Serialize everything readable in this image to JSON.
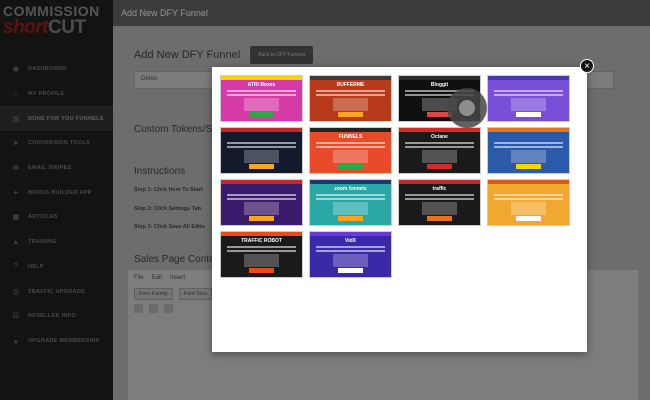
{
  "brand": {
    "line1": "COMMISSION",
    "short": "short",
    "cut": "CUT"
  },
  "sidebar": {
    "items": [
      {
        "label": "DASHBOARD",
        "icon": "dashboard-icon",
        "glyph": "◉"
      },
      {
        "label": "MY PROFILE",
        "icon": "user-icon",
        "glyph": "☺"
      },
      {
        "label": "DONE FOR YOU FUNNELS",
        "icon": "funnel-icon",
        "glyph": "▤",
        "active": true
      },
      {
        "label": "CONVERSION TOOLS",
        "icon": "send-icon",
        "glyph": "➤"
      },
      {
        "label": "EMAIL SWIPES",
        "icon": "email-icon",
        "glyph": "✉"
      },
      {
        "label": "BONUS BUILDER APP",
        "icon": "gift-icon",
        "glyph": "✦"
      },
      {
        "label": "ARTICLES",
        "icon": "document-icon",
        "glyph": "▦"
      },
      {
        "label": "TRAINING",
        "icon": "graduation-icon",
        "glyph": "▲"
      },
      {
        "label": "HELP",
        "icon": "help-icon",
        "glyph": "?"
      },
      {
        "label": "TRAFFIC UPGRADE",
        "icon": "traffic-icon",
        "glyph": "◷"
      },
      {
        "label": "RESELLER INFO",
        "icon": "reseller-icon",
        "glyph": "☷"
      },
      {
        "label": "UPGRADE MEMBERSHIP",
        "icon": "upgrade-icon",
        "glyph": "▴"
      }
    ]
  },
  "topbar": {
    "title": "Add New DFY Funnel"
  },
  "page": {
    "heading": "Add New DFY Funnel",
    "back_button": "Back to DFY Funnels",
    "name_value": "Demo",
    "custom_tokens": "Custom Tokens/S",
    "instructions": "Instructions",
    "step1": "Step 1: Click Here To Start",
    "step2": "Step 2: Click Settings Tab",
    "step3": "Step 3: Click Save All Edits",
    "sales_page": "Sales Page Conte",
    "toolbar": [
      "File",
      "Edit",
      "Insert"
    ],
    "font_family": "Font Family",
    "font_size": "Font Size"
  },
  "modal": {
    "close": "×",
    "templates": [
      {
        "name": "template-1",
        "title": "ATRI Boxes",
        "bg": "#d63aa7",
        "bar": "#f5d600",
        "btn": "#2aa84a"
      },
      {
        "name": "template-2",
        "title": "BUFFERME",
        "bg": "#b83a1a",
        "bar": "#3b3b3b",
        "btn": "#f5a623"
      },
      {
        "name": "template-3",
        "title": "Bloggit",
        "bg": "#101010",
        "bar": "#2d2d2d",
        "btn": "#e04545"
      },
      {
        "name": "template-4",
        "title": "",
        "bg": "#7a4fd8",
        "bar": "#4a3aa8",
        "btn": "#ffffff"
      },
      {
        "name": "template-5",
        "title": "",
        "bg": "#121a2c",
        "bar": "#c02a2a",
        "btn": "#f5a623"
      },
      {
        "name": "template-6",
        "title": "FUNNELS",
        "bg": "#e84a2a",
        "bar": "#222222",
        "btn": "#2aa84a"
      },
      {
        "name": "template-7",
        "title": "Octane",
        "bg": "#1a1a1a",
        "bar": "#d02a2a",
        "btn": "#d02a2a"
      },
      {
        "name": "template-8",
        "title": "",
        "bg": "#2a5aa8",
        "bar": "#e8731a",
        "btn": "#f5d600"
      },
      {
        "name": "template-9",
        "title": "",
        "bg": "#3a1a6a",
        "bar": "#c02a2a",
        "btn": "#f5a623"
      },
      {
        "name": "template-10",
        "title": "zoom funnels",
        "bg": "#2aa8a8",
        "bar": "#1a3a6a",
        "btn": "#f5a623"
      },
      {
        "name": "template-11",
        "title": "traffic",
        "bg": "#1a1a1a",
        "bar": "#c02a2a",
        "btn": "#e8731a"
      },
      {
        "name": "template-12",
        "title": "",
        "bg": "#f0a830",
        "bar": "#d85a1a",
        "btn": "#ffffff"
      },
      {
        "name": "template-13",
        "title": "TRAFFIC ROBOT",
        "bg": "#1a1a1a",
        "bar": "#e84a1a",
        "btn": "#e84a1a"
      },
      {
        "name": "template-14",
        "title": "VidX",
        "bg": "#3a2aa8",
        "bar": "#6a3ad8",
        "btn": "#ffffff"
      }
    ]
  },
  "colors": {
    "active_bg": "#2d2d2d",
    "brand_red": "#8a1a1a"
  }
}
